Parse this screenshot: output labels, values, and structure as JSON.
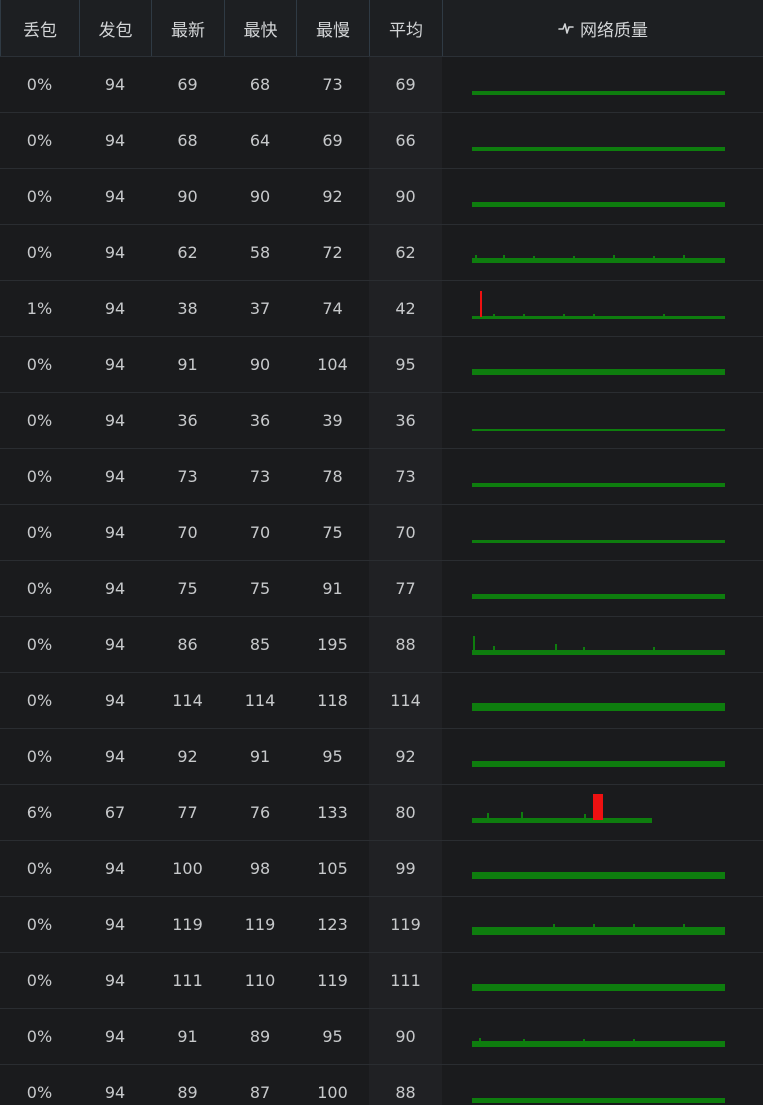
{
  "columns": {
    "loss": "丢包",
    "sent": "发包",
    "latest": "最新",
    "fastest": "最快",
    "slowest": "最慢",
    "average": "平均",
    "quality": "网络质量"
  },
  "icons": {
    "quality": "pulse-icon"
  },
  "colors": {
    "good": "#0e7d0e",
    "bad": "#ee1111"
  },
  "rows": [
    {
      "loss": "0%",
      "sent": "94",
      "latest": "69",
      "fastest": "68",
      "slowest": "73",
      "average": "69",
      "quality_fill": 1.0
    },
    {
      "loss": "0%",
      "sent": "94",
      "latest": "68",
      "fastest": "64",
      "slowest": "69",
      "average": "66",
      "quality_fill": 1.0
    },
    {
      "loss": "0%",
      "sent": "94",
      "latest": "90",
      "fastest": "90",
      "slowest": "92",
      "average": "90",
      "quality_fill": 1.0
    },
    {
      "loss": "0%",
      "sent": "94",
      "latest": "62",
      "fastest": "58",
      "slowest": "72",
      "average": "62",
      "quality_fill": 1.0
    },
    {
      "loss": "1%",
      "sent": "94",
      "latest": "38",
      "fastest": "37",
      "slowest": "74",
      "average": "42",
      "quality_fill": 1.0
    },
    {
      "loss": "0%",
      "sent": "94",
      "latest": "91",
      "fastest": "90",
      "slowest": "104",
      "average": "95",
      "quality_fill": 1.0
    },
    {
      "loss": "0%",
      "sent": "94",
      "latest": "36",
      "fastest": "36",
      "slowest": "39",
      "average": "36",
      "quality_fill": 1.0
    },
    {
      "loss": "0%",
      "sent": "94",
      "latest": "73",
      "fastest": "73",
      "slowest": "78",
      "average": "73",
      "quality_fill": 1.0
    },
    {
      "loss": "0%",
      "sent": "94",
      "latest": "70",
      "fastest": "70",
      "slowest": "75",
      "average": "70",
      "quality_fill": 1.0
    },
    {
      "loss": "0%",
      "sent": "94",
      "latest": "75",
      "fastest": "75",
      "slowest": "91",
      "average": "77",
      "quality_fill": 1.0
    },
    {
      "loss": "0%",
      "sent": "94",
      "latest": "86",
      "fastest": "85",
      "slowest": "195",
      "average": "88",
      "quality_fill": 1.0
    },
    {
      "loss": "0%",
      "sent": "94",
      "latest": "114",
      "fastest": "114",
      "slowest": "118",
      "average": "114",
      "quality_fill": 1.0
    },
    {
      "loss": "0%",
      "sent": "94",
      "latest": "92",
      "fastest": "91",
      "slowest": "95",
      "average": "92",
      "quality_fill": 1.0
    },
    {
      "loss": "6%",
      "sent": "67",
      "latest": "77",
      "fastest": "76",
      "slowest": "133",
      "average": "80",
      "quality_fill": 0.71
    },
    {
      "loss": "0%",
      "sent": "94",
      "latest": "100",
      "fastest": "98",
      "slowest": "105",
      "average": "99",
      "quality_fill": 1.0
    },
    {
      "loss": "0%",
      "sent": "94",
      "latest": "119",
      "fastest": "119",
      "slowest": "123",
      "average": "119",
      "quality_fill": 1.0
    },
    {
      "loss": "0%",
      "sent": "94",
      "latest": "111",
      "fastest": "110",
      "slowest": "119",
      "average": "111",
      "quality_fill": 1.0
    },
    {
      "loss": "0%",
      "sent": "94",
      "latest": "91",
      "fastest": "89",
      "slowest": "95",
      "average": "90",
      "quality_fill": 1.0
    },
    {
      "loss": "0%",
      "sent": "94",
      "latest": "89",
      "fastest": "87",
      "slowest": "100",
      "average": "88",
      "quality_fill": 1.0
    }
  ]
}
